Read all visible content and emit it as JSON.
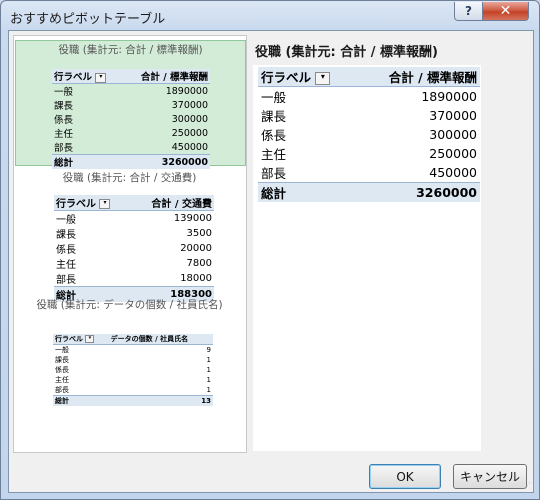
{
  "window": {
    "title": "おすすめピボットテーブル",
    "help": "?",
    "close": "✕"
  },
  "previews": [
    {
      "title": "役職 (集計元: 合計 / 標準報酬)",
      "header_label": "行ラベル",
      "header_value": "合計 / 標準報酬",
      "rows": [
        {
          "label": "一般",
          "value": "1890000"
        },
        {
          "label": "課長",
          "value": "370000"
        },
        {
          "label": "係長",
          "value": "300000"
        },
        {
          "label": "主任",
          "value": "250000"
        },
        {
          "label": "部長",
          "value": "450000"
        }
      ],
      "total_label": "総計",
      "total_value": "3260000"
    },
    {
      "title": "役職 (集計元: 合計 / 交通費)",
      "header_label": "行ラベル",
      "header_value": "合計 / 交通費",
      "rows": [
        {
          "label": "一般",
          "value": "139000"
        },
        {
          "label": "課長",
          "value": "3500"
        },
        {
          "label": "係長",
          "value": "20000"
        },
        {
          "label": "主任",
          "value": "7800"
        },
        {
          "label": "部長",
          "value": "18000"
        }
      ],
      "total_label": "総計",
      "total_value": "188300"
    },
    {
      "title": "役職 (集計元: データの個数 / 社員氏名)",
      "header_label": "行ラベル",
      "header_value": "データの個数 / 社員氏名",
      "rows": [
        {
          "label": "一般",
          "value": "9"
        },
        {
          "label": "課長",
          "value": "1"
        },
        {
          "label": "係長",
          "value": "1"
        },
        {
          "label": "主任",
          "value": "1"
        },
        {
          "label": "部長",
          "value": "1"
        }
      ],
      "total_label": "総計",
      "total_value": "13"
    }
  ],
  "detail": {
    "title": "役職 (集計元: 合計 / 標準報酬)",
    "header_label": "行ラベル",
    "header_value": "合計 / 標準報酬",
    "rows": [
      {
        "label": "一般",
        "value": "1890000"
      },
      {
        "label": "課長",
        "value": "370000"
      },
      {
        "label": "係長",
        "value": "300000"
      },
      {
        "label": "主任",
        "value": "250000"
      },
      {
        "label": "部長",
        "value": "450000"
      }
    ],
    "total_label": "総計",
    "total_value": "3260000"
  },
  "buttons": {
    "ok": "OK",
    "cancel": "キャンセル"
  }
}
